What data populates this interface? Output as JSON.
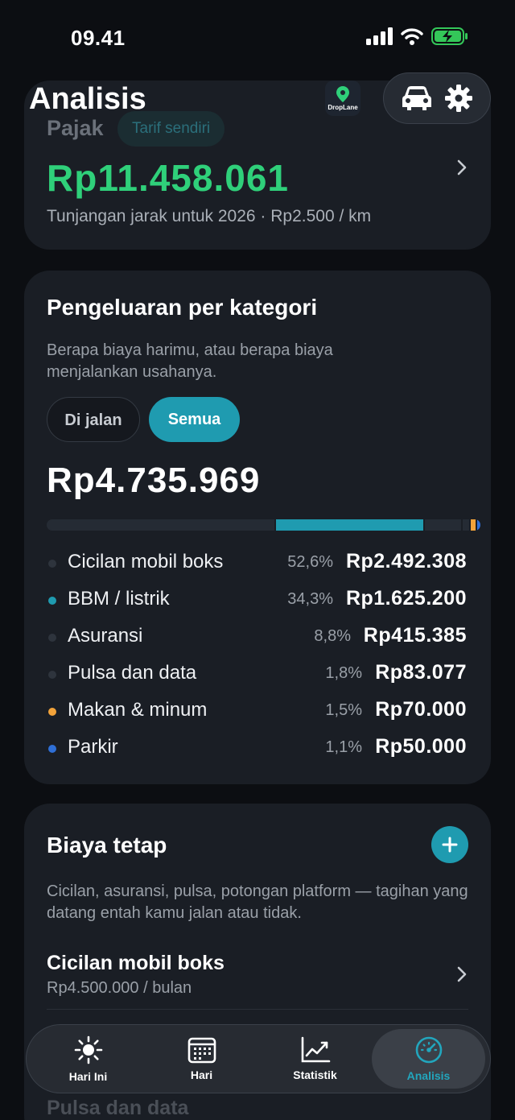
{
  "status_bar": {
    "time": "09.41"
  },
  "header": {
    "title": "Analisis",
    "logo_text": "DropLane"
  },
  "tax_card": {
    "label": "Pajak",
    "chip": "Tarif sendiri",
    "value": "Rp11.458.061",
    "subtitle": "Tunjangan jarak untuk 2026 · Rp2.500 / km"
  },
  "category_card": {
    "title": "Pengeluaran per kategori",
    "description": "Berapa biaya harimu, atau berapa biaya menjalankan usahanya.",
    "segment_inactive": "Di jalan",
    "segment_active": "Semua",
    "total": "Rp4.735.969",
    "items": [
      {
        "name": "Cicilan mobil boks",
        "percent": "52,6%",
        "amount": "Rp2.492.308",
        "share": 52.6,
        "color": "#252b34"
      },
      {
        "name": "BBM / listrik",
        "percent": "34,3%",
        "amount": "Rp1.625.200",
        "share": 34.3,
        "color": "#1f9bb0"
      },
      {
        "name": "Asuransi",
        "percent": "8,8%",
        "amount": "Rp415.385",
        "share": 8.8,
        "color": "#252b34"
      },
      {
        "name": "Pulsa dan data",
        "percent": "1,8%",
        "amount": "Rp83.077",
        "share": 1.8,
        "color": "#252b34"
      },
      {
        "name": "Makan & minum",
        "percent": "1,5%",
        "amount": "Rp70.000",
        "share": 1.5,
        "color": "#f2a33a"
      },
      {
        "name": "Parkir",
        "percent": "1,1%",
        "amount": "Rp50.000",
        "share": 1.1,
        "color": "#2f6fd6"
      }
    ]
  },
  "fixed_card": {
    "title": "Biaya tetap",
    "description": "Cicilan, asuransi, pulsa, potongan platform — tagihan yang datang entah kamu jalan atau tidak.",
    "items": [
      {
        "name": "Cicilan mobil boks",
        "sub": "Rp4.500.000 / bulan"
      },
      {
        "name": "Pulsa dan data"
      }
    ]
  },
  "tabbar": {
    "tabs": [
      {
        "label": "Hari Ini",
        "icon": "sun-icon"
      },
      {
        "label": "Hari",
        "icon": "calendar-icon"
      },
      {
        "label": "Statistik",
        "icon": "chart-icon"
      },
      {
        "label": "Analisis",
        "icon": "gauge-icon"
      }
    ]
  }
}
